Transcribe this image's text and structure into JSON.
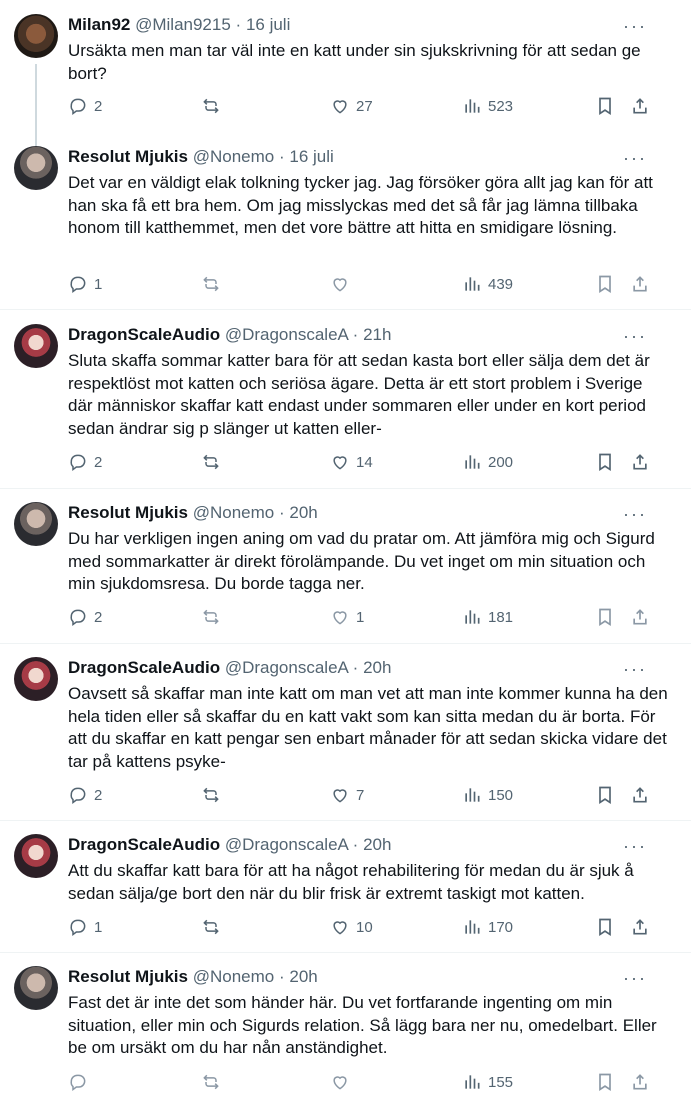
{
  "tweets": [
    {
      "name": "Milan92",
      "handle": "@Milan9215",
      "time": "16 juli",
      "text": "Ursäkta men man tar väl inte en katt under sin sjukskrivning för att sedan ge bort?",
      "replies": "2",
      "retweets": "",
      "likes": "27",
      "views": "523"
    },
    {
      "name": "Resolut Mjukis",
      "handle": "@Nonemo",
      "time": "16 juli",
      "text": "Det var en väldigt elak tolkning tycker jag. Jag försöker göra allt jag kan för att han ska få ett bra hem. Om jag misslyckas med det så får jag lämna tillbaka honom till katthemmet, men det vore bättre att hitta en smidigare lösning.",
      "replies": "1",
      "retweets": "",
      "likes": "",
      "views": "439"
    },
    {
      "name": "DragonScaleAudio",
      "handle": "@DragonscaleA",
      "time": "21h",
      "text": "Sluta skaffa sommar katter bara för att sedan kasta bort eller sälja dem det är respektlöst mot katten och seriösa ägare. Detta är ett stort problem i Sverige där människor skaffar katt endast under sommaren eller under en kort period sedan ändrar sig p slänger ut katten eller-",
      "replies": "2",
      "retweets": "",
      "likes": "14",
      "views": "200"
    },
    {
      "name": "Resolut Mjukis",
      "handle": "@Nonemo",
      "time": "20h",
      "text": "Du har verkligen ingen aning om vad du pratar om. Att jämföra mig och Sigurd med sommarkatter är direkt förolämpande. Du vet inget om min situation och min sjukdomsresa. Du borde tagga ner.",
      "replies": "2",
      "retweets": "",
      "likes": "1",
      "views": "181"
    },
    {
      "name": "DragonScaleAudio",
      "handle": "@DragonscaleA",
      "time": "20h",
      "text": "Oavsett så skaffar man inte katt om man vet att man inte kommer kunna ha den hela tiden eller så skaffar du en katt vakt som kan sitta medan du är borta. För att du skaffar en katt pengar sen enbart månader för att sedan skicka vidare det tar på kattens psyke-",
      "replies": "2",
      "retweets": "",
      "likes": "7",
      "views": "150"
    },
    {
      "name": "DragonScaleAudio",
      "handle": "@DragonscaleA",
      "time": "20h",
      "text": "Att du skaffar katt bara för att ha något rehabilitering för medan du är sjuk å sedan sälja/ge bort den när du blir frisk är extremt taskigt mot katten.",
      "replies": "1",
      "retweets": "",
      "likes": "10",
      "views": "170"
    },
    {
      "name": "Resolut Mjukis",
      "handle": "@Nonemo",
      "time": "20h",
      "text": "Fast det är inte det som händer här. Du vet fortfarande ingenting om min situation, eller min och Sigurds relation. Så lägg bara ner nu, omedelbart. Eller be om ursäkt om du har nån anständighet.",
      "replies": "",
      "retweets": "",
      "likes": "",
      "views": "155"
    }
  ],
  "ui": {
    "separator": "·",
    "more_glyph": "···"
  },
  "icons": [
    "reply-icon",
    "retweet-icon",
    "like-icon",
    "views-icon",
    "bookmark-icon",
    "share-icon"
  ],
  "colors": {
    "text": "#0f1419",
    "secondary": "#536471",
    "thread_line": "#cfd9de",
    "divider": "#eff3f4"
  }
}
